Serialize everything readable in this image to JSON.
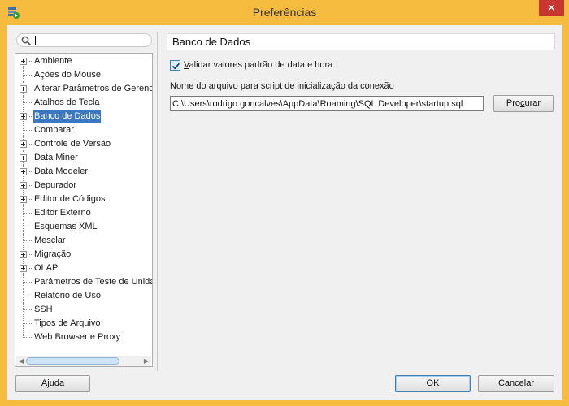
{
  "window": {
    "title": "Preferências",
    "close_glyph": "✕"
  },
  "search": {
    "value": ""
  },
  "tree": {
    "items": [
      {
        "label": "Ambiente",
        "expandable": true,
        "selected": false
      },
      {
        "label": "Ações do Mouse",
        "expandable": false,
        "selected": false
      },
      {
        "label": "Alterar Parâmetros de Gerenci",
        "expandable": true,
        "selected": false
      },
      {
        "label": "Atalhos de Tecla",
        "expandable": false,
        "selected": false
      },
      {
        "label": "Banco de Dados",
        "expandable": true,
        "selected": true
      },
      {
        "label": "Comparar",
        "expandable": false,
        "selected": false
      },
      {
        "label": "Controle de Versão",
        "expandable": true,
        "selected": false
      },
      {
        "label": "Data Miner",
        "expandable": true,
        "selected": false
      },
      {
        "label": "Data Modeler",
        "expandable": true,
        "selected": false
      },
      {
        "label": "Depurador",
        "expandable": true,
        "selected": false
      },
      {
        "label": "Editor de Códigos",
        "expandable": true,
        "selected": false
      },
      {
        "label": "Editor Externo",
        "expandable": false,
        "selected": false
      },
      {
        "label": "Esquemas XML",
        "expandable": false,
        "selected": false
      },
      {
        "label": "Mesclar",
        "expandable": false,
        "selected": false
      },
      {
        "label": "Migração",
        "expandable": true,
        "selected": false
      },
      {
        "label": "OLAP",
        "expandable": true,
        "selected": false
      },
      {
        "label": "Parâmetros de Teste de Unida",
        "expandable": false,
        "selected": false
      },
      {
        "label": "Relatório de Uso",
        "expandable": false,
        "selected": false
      },
      {
        "label": "SSH",
        "expandable": false,
        "selected": false
      },
      {
        "label": "Tipos de Arquivo",
        "expandable": false,
        "selected": false
      },
      {
        "label": "Web Browser e Proxy",
        "expandable": false,
        "selected": false
      }
    ]
  },
  "panel": {
    "title": "Banco de Dados",
    "checkbox": {
      "label_mnemonic": "V",
      "label_rest": "alidar valores padrão de data e hora",
      "checked": true
    },
    "field_label": "Nome do arquivo para script de inicialização da conexão",
    "path_value": "C:\\Users\\rodrigo.goncalves\\AppData\\Roaming\\SQL Developer\\startup.sql",
    "browse": {
      "pre": "Pro",
      "mnemonic": "c",
      "post": "urar"
    }
  },
  "footer": {
    "help": {
      "mnemonic": "A",
      "rest": "juda"
    },
    "ok_label": "OK",
    "cancel_label": "Cancelar"
  },
  "colors": {
    "titlebar": "#f6bc3f",
    "selection": "#3a78c2",
    "close": "#c7372f"
  }
}
